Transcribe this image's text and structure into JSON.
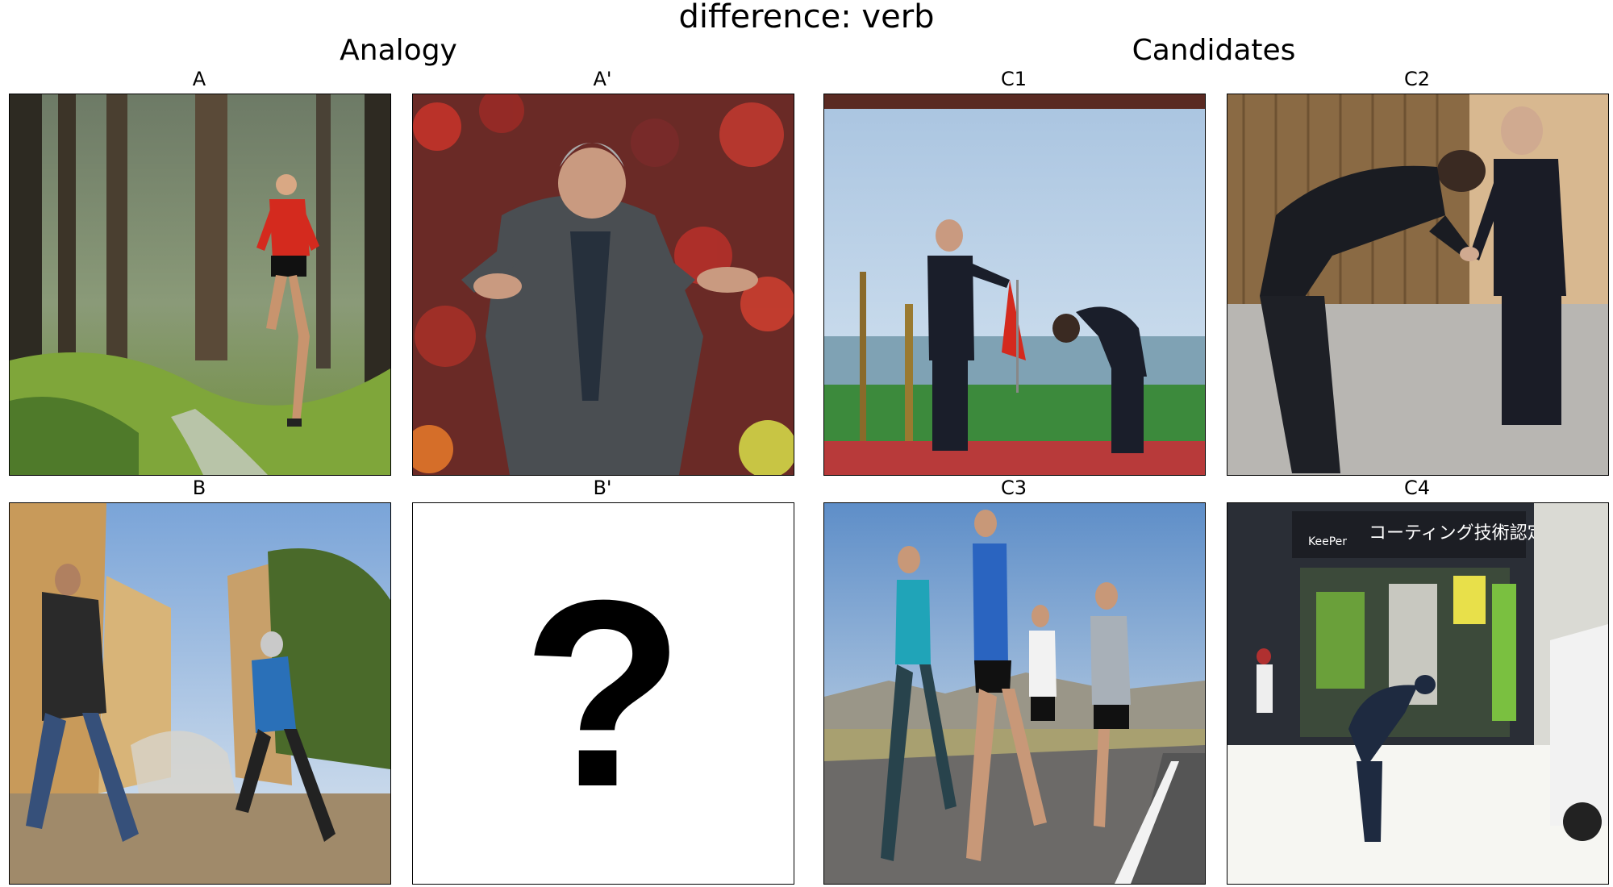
{
  "title": "difference: verb",
  "sections": {
    "analogy": "Analogy",
    "candidates": "Candidates"
  },
  "panels": {
    "A": {
      "label": "A"
    },
    "A_prime": {
      "label": "A'"
    },
    "B": {
      "label": "B"
    },
    "B_prime": {
      "label": "B'",
      "placeholder": "?"
    },
    "C1": {
      "label": "C1"
    },
    "C2": {
      "label": "C2"
    },
    "C3": {
      "label": "C3"
    },
    "C4": {
      "label": "C4",
      "sign_text": "コーティング技術認定店",
      "sign_brand": "KeePer"
    }
  }
}
